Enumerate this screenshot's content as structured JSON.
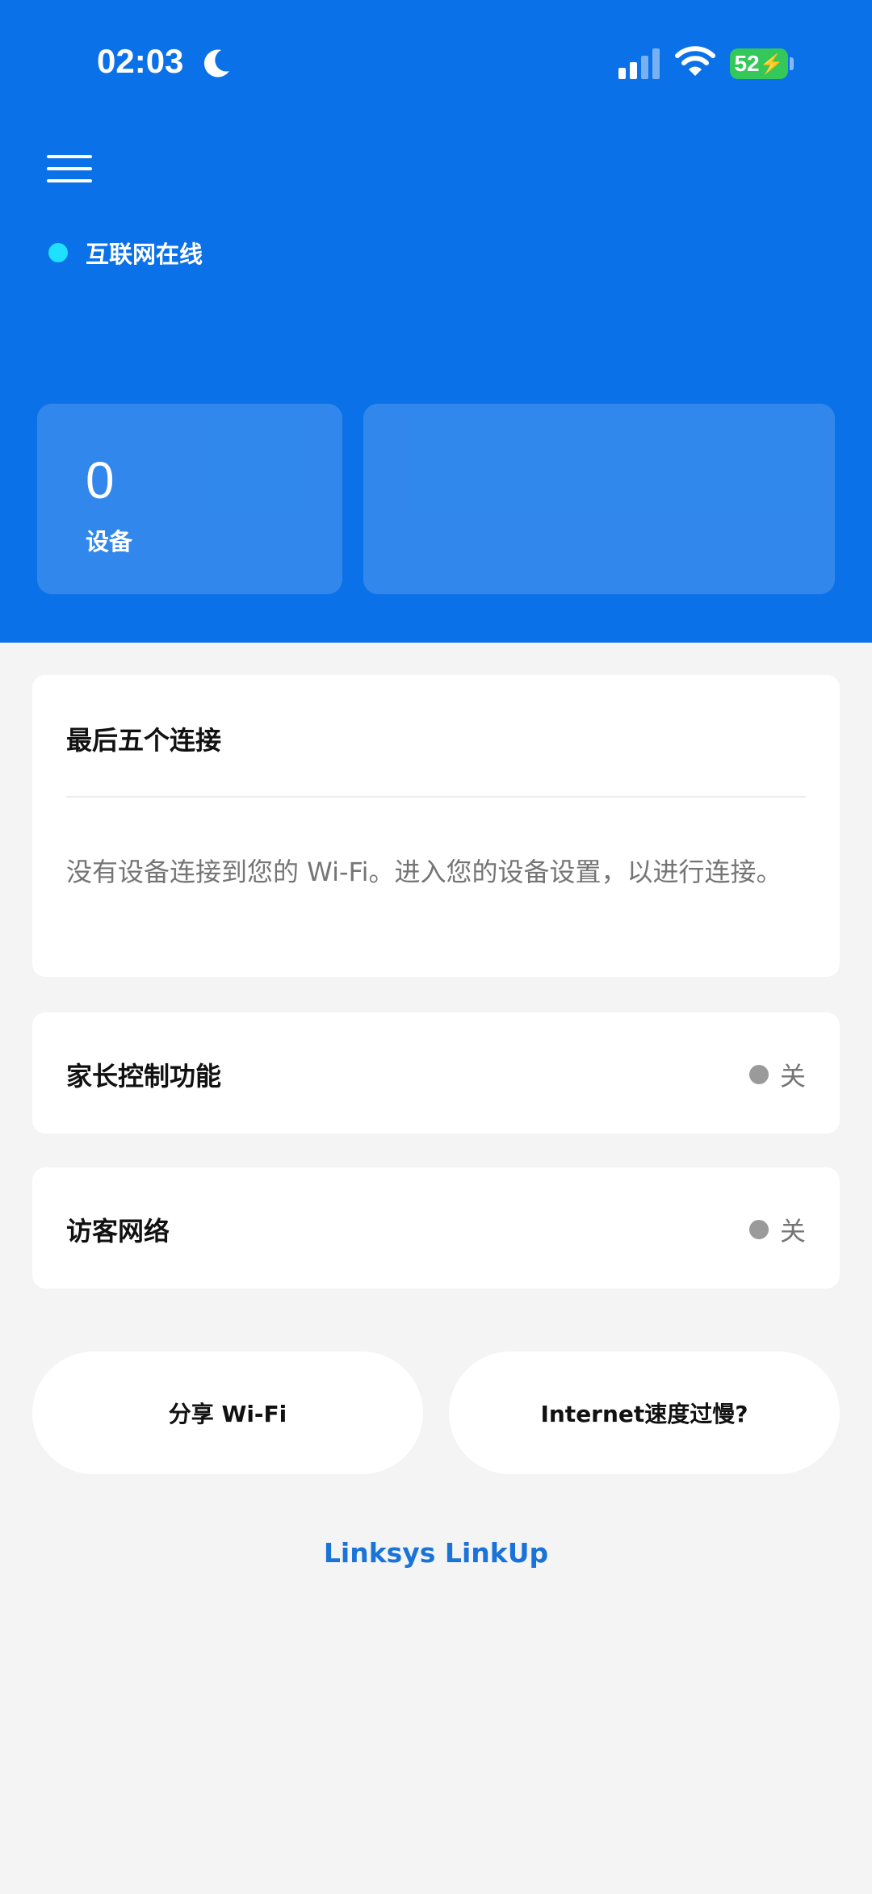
{
  "status_bar": {
    "time": "02:03",
    "battery": "52",
    "icons": [
      "moon-icon",
      "cellular-signal-icon",
      "wifi-icon",
      "battery-charging-icon"
    ]
  },
  "header": {
    "menu_icon": "hamburger-menu-icon",
    "internet_status": "互联网在线",
    "status_color": "#1ee0ff",
    "device_count": "0",
    "device_label": "设备"
  },
  "recent_connections": {
    "title": "最后五个连接",
    "empty_message": "没有设备连接到您的 Wi-Fi。进入您的设备设置，以进行连接。"
  },
  "parental_controls": {
    "label": "家长控制功能",
    "status": "关"
  },
  "guest_network": {
    "label": "访客网络",
    "status": "关"
  },
  "buttons": {
    "share_wifi": "分享 Wi-Fi",
    "slow_internet": "Internet速度过慢?"
  },
  "footer_link": "Linksys LinkUp",
  "colors": {
    "header_blue": "#0a71e8",
    "link_blue": "#1a73d8",
    "battery_green": "#34c759",
    "off_dot": "#9a9a9a"
  }
}
